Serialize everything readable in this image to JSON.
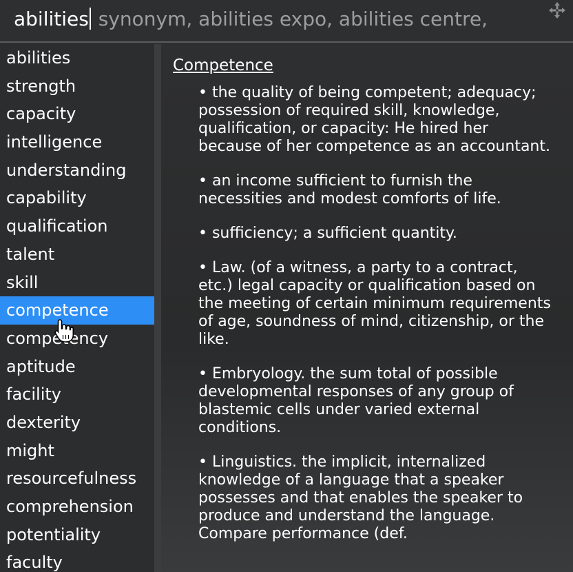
{
  "search": {
    "query": "abilities",
    "suggestions": " synonym,  abilities expo,  abilities centre,"
  },
  "sidebar": {
    "items": [
      {
        "label": "abilities"
      },
      {
        "label": "strength"
      },
      {
        "label": "capacity"
      },
      {
        "label": "intelligence"
      },
      {
        "label": "understanding"
      },
      {
        "label": "capability"
      },
      {
        "label": "qualification"
      },
      {
        "label": "talent"
      },
      {
        "label": "skill"
      },
      {
        "label": "competence"
      },
      {
        "label": "competency"
      },
      {
        "label": "aptitude"
      },
      {
        "label": "facility"
      },
      {
        "label": "dexterity"
      },
      {
        "label": "might"
      },
      {
        "label": "resourcefulness"
      },
      {
        "label": "comprehension"
      },
      {
        "label": "potentiality"
      },
      {
        "label": "faculty"
      }
    ],
    "selected": "competence"
  },
  "definition": {
    "term": "Competence",
    "senses": [
      "• the quality of being competent; adequacy; possession of required skill, knowledge, qualification, or capacity: He hired her because of her competence as an accountant.",
      "• an income sufficient to furnish the necessities and modest comforts of life.",
      "• sufficiency; a sufficient quantity.",
      "• Law. (of a witness, a party to a contract, etc.) legal capacity or qualification based on the meeting of certain minimum requirements of age, soundness of mind, citizenship, or the like.",
      "• Embryology. the sum total of possible developmental responses of any group of blastemic cells under varied external conditions.",
      "• Linguistics. the implicit, internalized knowledge of a language that a speaker possesses and that enables the speaker to produce and understand the language. Compare performance (def."
    ]
  },
  "icons": {
    "move": "move-arrows-icon",
    "cursor": "hand-pointer-icon"
  },
  "colors": {
    "selection": "#2d8ef5",
    "suggestion_text": "#9d9ea0",
    "background": "#2b2c2d"
  }
}
